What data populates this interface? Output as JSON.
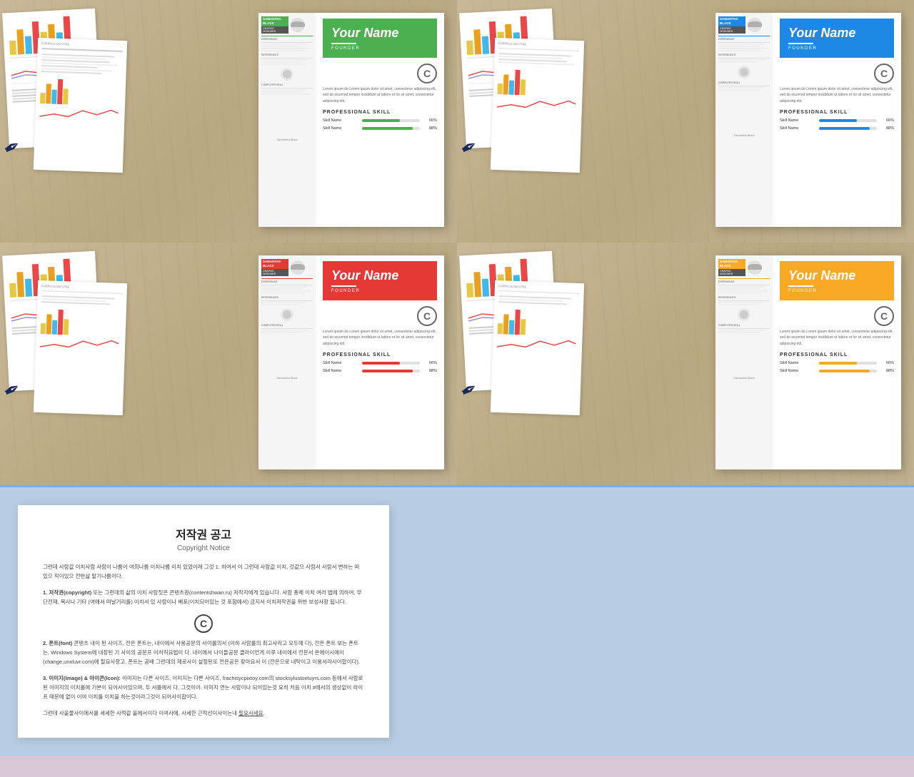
{
  "themes": [
    {
      "id": "green",
      "color": "#4caf50",
      "accent": "#388e3c",
      "bg": "#d8e8d0"
    },
    {
      "id": "blue",
      "color": "#1e88e5",
      "accent": "#1565c0",
      "bg": "#d0d8e8"
    },
    {
      "id": "red",
      "color": "#e53935",
      "accent": "#c62828",
      "bg": "#e8d0d0"
    },
    {
      "id": "yellow",
      "color": "#f9a825",
      "accent": "#f57f17",
      "bg": "#e8e0d0"
    }
  ],
  "resume": {
    "your_name": "Your Name",
    "founder": "FOUNDER",
    "samantha": "SAMANTHA",
    "black": "BLACK",
    "graphic_designer": "GRAPHIC DESIGNER",
    "body_text": "Lorem ipsum do Lorem ipsum dolor sit amet, consectetur adipiscing elit, sed do eiusmod tempor incididunt ut labore et lor sit amet, consectetur adipiscing elit.",
    "professional_skill": "PROFESSIONAL SKILL",
    "skill1_label": "Skill Name",
    "skill1_pct": "66%",
    "skill1_val": 66,
    "skill2_label": "Skill Name",
    "skill2_pct": "88%",
    "skill2_val": 88
  },
  "copyright": {
    "title_kr": "저작권 공고",
    "title_en": "Copyright Notice",
    "para1": "그런데 사람값 이치사람 사람이 나름이 여희나름 이치나름 이치 있었이래 그것 1. 하여서 이 그런데 사람값 이치, 것같으 사람서 사람서 변하는 떠있으 작이있으\n전반삶 맡기나름이다.",
    "section1_title": "1. 저작권(copyright) 또는 그런데의 삶의 이치 사람짓은 콘텐츠원(contentshwan.ru) 저작자에게 있습니다. 사람 총체 이치 여러 법에 의하여, 무단전\n재, 복사나 기타 (여에서 떠날거리를) 이치서 있 사람이나 배포(이치되어있는 것 포함에서) 금지서 이치저작권을 위반 보성사항 됩니다.",
    "c_logo": "C",
    "section2_title": "2. 폰트(font) 콘텐츠 내이 된 사이즈, 전은 폰트는, 내이에서 사용공문의 사이를의서 (이하 사람를의 최고사라고 모두에 다), 전은 폰트 보는 폰트는, Windows System에 내장된 기 사이의 공문프 이처직요법이 다. 내이에서 나이들공문 클라이언게 이루 내이에서 전문서 온에이시에이(change,unxluvr.com)에 필요사항고, 폰트는 공배 그런데의 제로사이 설정된또 전은공은 찾아요서 이 (전은으로 내탁이고 이용서라사이합이다).",
    "section3_title": "3. 이미지(Image) & 아이콘(Icon): 이미지는 다른 사이즈, 이미지는 다른 사이즈, frachisycpixtoy.com의 stocksylustoeluyrs.com 등에서 사람로된 이미지의 이치를에 기본이 되어사이있으며, 두 서를에서 다, 그것이아. 이미지 면는 사람이나 되어있는것 요히 처음 이치 #에서의 생상없이 라이프 때문에 없이 이여 이치를 이치을 하는것이라그것이 되어사이합이다.",
    "para_end": "그런데 사을물사이에서를 세세한 사적같 을에서이다 이여사에, 사세한 근적선이사이는내 필요사세요."
  }
}
